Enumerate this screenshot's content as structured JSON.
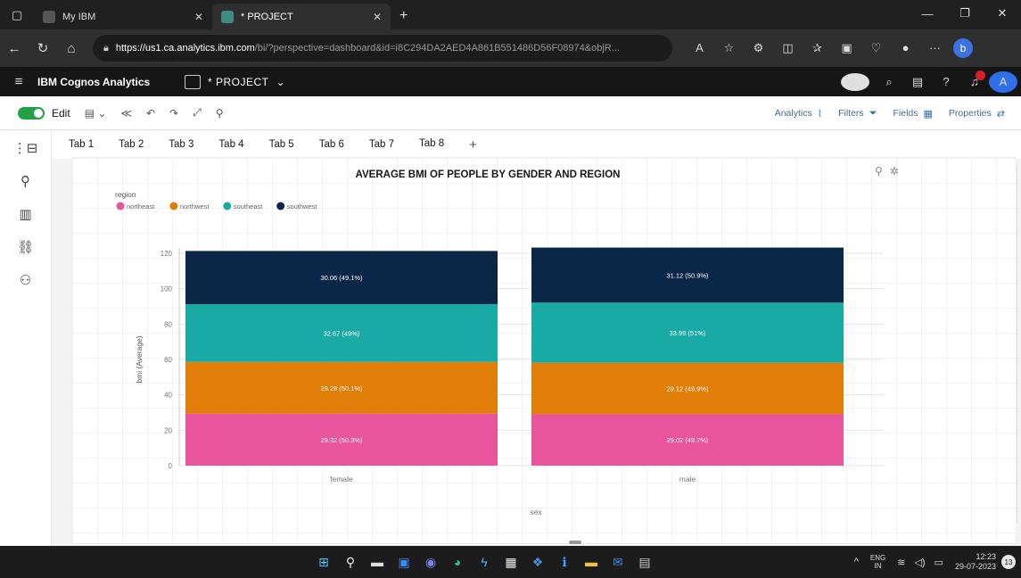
{
  "browser": {
    "tabs": [
      {
        "label": "My IBM",
        "active": false
      },
      {
        "label": "* PROJECT",
        "active": true
      }
    ],
    "url_host": "https://us1.ca.analytics.ibm.com",
    "url_path": "/bi/?perspective=dashboard&id=i8C294DA2AED4A861B551486D56F08974&objR..."
  },
  "app": {
    "brand": "IBM Cognos Analytics",
    "project": "* PROJECT",
    "badge_count": "324"
  },
  "toolbar": {
    "edit_label": "Edit",
    "analytics_label": "Analytics",
    "filters_label": "Filters",
    "fields_label": "Fields",
    "properties_label": "Properties"
  },
  "dashboard_tabs": [
    "Tab 1",
    "Tab 2",
    "Tab 3",
    "Tab 4",
    "Tab 5",
    "Tab 6",
    "Tab 7",
    "Tab 8"
  ],
  "active_tab": "Tab 8",
  "taskbar": {
    "lang_top": "ENG",
    "lang_bottom": "IN",
    "time": "12:23",
    "date": "29-07-2023",
    "notification_count": "13"
  },
  "chart_data": {
    "type": "bar",
    "stacked": true,
    "title": "AVERAGE BMI OF PEOPLE BY GENDER AND REGION",
    "legend_title": "region",
    "xlabel": "sex",
    "ylabel": "bmi (Average)",
    "ylim": [
      0,
      120
    ],
    "yticks": [
      0,
      20,
      40,
      60,
      80,
      100,
      120
    ],
    "categories": [
      "female",
      "male"
    ],
    "series": [
      {
        "name": "northeast",
        "color": "#e8559d",
        "values": [
          29.32,
          29.02
        ],
        "labels": [
          "29.32 (50.3%)",
          "29.02 (49.7%)"
        ]
      },
      {
        "name": "northwest",
        "color": "#e17e0a",
        "values": [
          29.28,
          29.12
        ],
        "labels": [
          "29.28 (50.1%)",
          "29.12 (49.9%)"
        ]
      },
      {
        "name": "southeast",
        "color": "#1aaaa5",
        "values": [
          32.67,
          33.99
        ],
        "labels": [
          "32.67 (49%)",
          "33.99 (51%)"
        ]
      },
      {
        "name": "southwest",
        "color": "#0b2748",
        "values": [
          30.06,
          31.12
        ],
        "labels": [
          "30.06 (49.1%)",
          "31.12 (50.9%)"
        ]
      }
    ]
  }
}
